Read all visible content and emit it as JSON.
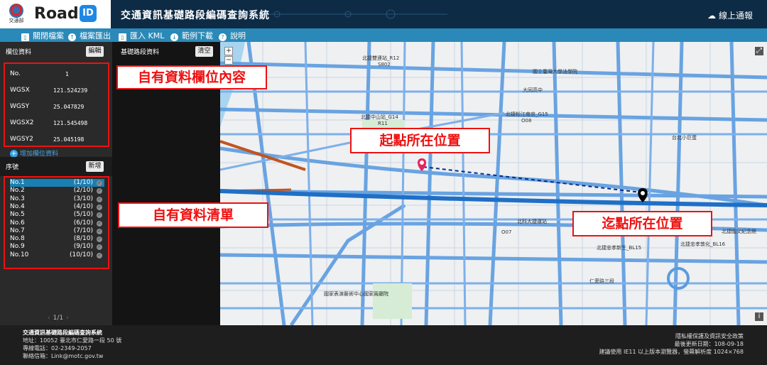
{
  "header": {
    "ministry_text": "交通部",
    "brand": "Road",
    "brand_badge": "ID",
    "system_title": "交通資訊基礎路段編碼查詢系統",
    "report_link": "線上通報"
  },
  "toolbar": {
    "items": [
      {
        "label": "關閉檔案"
      },
      {
        "label": "檔案匯出"
      },
      {
        "label": "匯入 KML"
      },
      {
        "label": "範例下載"
      },
      {
        "label": "說明"
      }
    ]
  },
  "field_panel": {
    "title": "欄位資料",
    "edit_button": "編輯",
    "fields": [
      {
        "name": "No.",
        "value": "1"
      },
      {
        "name": "WGSX",
        "value": "121.524239"
      },
      {
        "name": "WGSY",
        "value": "25.047829"
      },
      {
        "name": "WGSX2",
        "value": "121.545498"
      },
      {
        "name": "WGSY2",
        "value": "25.045198"
      }
    ],
    "add_field": "增加欄位資料"
  },
  "list_panel": {
    "title": "序號",
    "new_button": "新增",
    "rows": [
      {
        "no": "No.1",
        "count": "(1/10)"
      },
      {
        "no": "No.2",
        "count": "(2/10)"
      },
      {
        "no": "No.3",
        "count": "(3/10)"
      },
      {
        "no": "No.4",
        "count": "(4/10)"
      },
      {
        "no": "No.5",
        "count": "(5/10)"
      },
      {
        "no": "No.6",
        "count": "(6/10)"
      },
      {
        "no": "No.7",
        "count": "(7/10)"
      },
      {
        "no": "No.8",
        "count": "(8/10)"
      },
      {
        "no": "No.9",
        "count": "(9/10)"
      },
      {
        "no": "No.10",
        "count": "(10/10)"
      }
    ],
    "pager": "1/1"
  },
  "segment_panel": {
    "title": "基礎路段資料",
    "clear_button": "清空"
  },
  "map": {
    "labels": [
      "北捷雙連站_R12",
      "S802",
      "北捷中山站_G14",
      "R11",
      "大同高中",
      "北捷松江南京_G15",
      "O08",
      "國立臺灣大學法學院",
      "北捷忠孝新生_BL15",
      "北捷忠孝敦化_BL16",
      "北捷國父紀念館",
      "國家表演藝術中心國家兩廳院",
      "北科大捷運站",
      "仁愛路三段",
      "O07",
      "台北小巨蛋"
    ],
    "zoom_in": "+",
    "zoom_out": "−",
    "info": "i"
  },
  "annotations": {
    "own_fields": "自有資料欄位內容",
    "own_list": "自有資料清單",
    "start_point": "起點所在位置",
    "end_point": "迄點所在位置"
  },
  "footer": {
    "left": [
      "交通資訊基礎路段編碼查詢系統",
      "地址：10052 臺北市仁愛路一段 50 號",
      "專線電話：02-2349-2057",
      "聯絡信箱：Link@motc.gov.tw"
    ],
    "right": [
      "隱私權保護及資訊安全政策",
      "最後更新日期：108-09-18",
      "建議使用 IE11 以上版本瀏覽器，螢幕解析度 1024×768"
    ]
  },
  "colors": {
    "header_bg": "#0d2b45",
    "toolbar_bg": "#2a89b8",
    "road_blue": "#4a90e2",
    "annotation_red": "#e11",
    "start_marker": "#e8245a",
    "end_marker": "#000000"
  }
}
